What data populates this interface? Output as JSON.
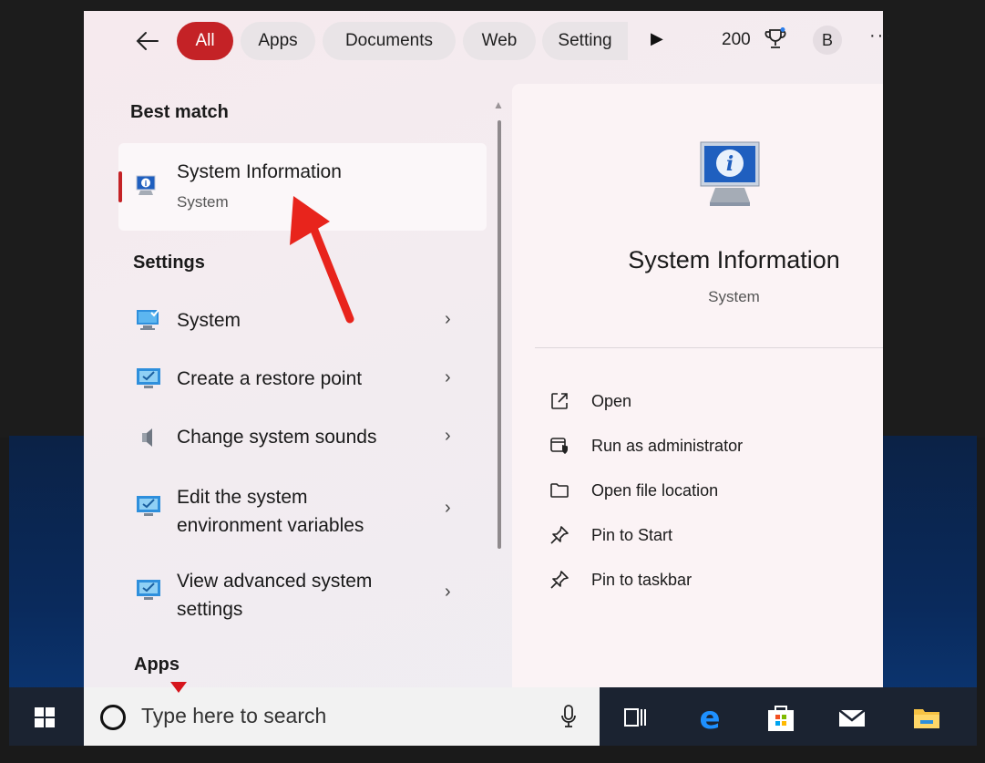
{
  "filters": {
    "tabs": [
      {
        "label": "All",
        "active": true
      },
      {
        "label": "Apps",
        "active": false
      },
      {
        "label": "Documents",
        "active": false
      },
      {
        "label": "Web",
        "active": false
      },
      {
        "label": "Setting",
        "active": false
      }
    ],
    "points": "200",
    "avatar_letter": "B",
    "more": "···"
  },
  "results": {
    "best_match_heading": "Best match",
    "best_match": {
      "title": "System Information",
      "subtitle": "System"
    },
    "settings_heading": "Settings",
    "settings": [
      {
        "line1": "System",
        "line2": "",
        "icon": "monitor-icon"
      },
      {
        "line1": "Create a restore point",
        "line2": "",
        "icon": "restore-icon"
      },
      {
        "line1": "Change system sounds",
        "line2": "",
        "icon": "speaker-icon"
      },
      {
        "line1": "Edit the system",
        "line2": "environment variables",
        "icon": "environment-icon"
      },
      {
        "line1": "View advanced system",
        "line2": "settings",
        "icon": "advanced-settings-icon"
      }
    ],
    "apps_heading": "Apps"
  },
  "detail": {
    "title": "System Information",
    "subtitle": "System",
    "actions": [
      {
        "label": "Open",
        "icon": "open-external-icon"
      },
      {
        "label": "Run as administrator",
        "icon": "shield-admin-icon"
      },
      {
        "label": "Open file location",
        "icon": "folder-icon"
      },
      {
        "label": "Pin to Start",
        "icon": "pin-icon"
      },
      {
        "label": "Pin to taskbar",
        "icon": "pin-icon"
      }
    ]
  },
  "taskbar": {
    "search_placeholder": "Type here to search",
    "icons": [
      "task-view-icon",
      "edge-icon",
      "store-icon",
      "mail-icon",
      "file-explorer-icon"
    ]
  },
  "colors": {
    "accent": "#c42226",
    "taskbar": "#1b2331",
    "annotation": "#e8241c"
  }
}
